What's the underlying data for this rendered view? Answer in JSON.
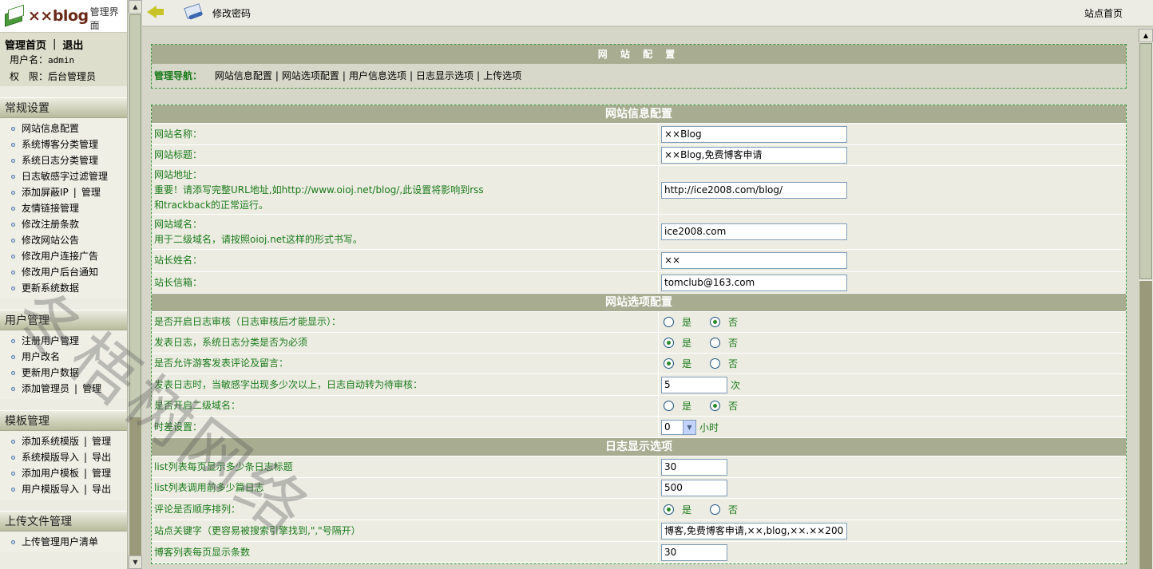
{
  "logo": {
    "brand": "××blog",
    "sub": "管理界面"
  },
  "user": {
    "home_link": "管理首页",
    "logout_link": "退出",
    "username_label": "用户名：",
    "username": "admin",
    "role_label": "权　限：",
    "role": "后台管理员"
  },
  "menu": {
    "s1": {
      "title": "常规设置",
      "items": [
        "网站信息配置",
        "系统博客分类管理",
        "系统日志分类管理",
        "日志敏感字过滤管理",
        "添加屏蔽IP",
        "管理",
        "友情链接管理",
        "修改注册条款",
        "修改网站公告",
        "修改用户连接广告",
        "修改用户后台通知",
        "更新系统数据"
      ]
    },
    "s2": {
      "title": "用户管理",
      "items": [
        "注册用户管理",
        "用户改名",
        "更新用户数据",
        "添加管理员",
        "管理"
      ]
    },
    "s3": {
      "title": "模板管理",
      "items": [
        "添加系统模版",
        "管理",
        "系统模版导入",
        "导出",
        "添加用户模板",
        "管理",
        "用户模版导入",
        "导出"
      ]
    },
    "s4": {
      "title": "上传文件管理",
      "items": [
        "上传管理用户清单"
      ]
    }
  },
  "topbar": {
    "title": "修改密码",
    "home": "站点首页"
  },
  "nav": {
    "header": "网 站 配 置",
    "label": "管理导航：",
    "links": [
      "网站信息配置",
      "网站选项配置",
      "用户信息选项",
      "日志显示选项",
      "上传选项"
    ]
  },
  "sections": {
    "info": {
      "title": "网站信息配置",
      "site_name_label": "网站名称：",
      "site_name": "××Blog",
      "site_title_label": "网站标题：",
      "site_title": "××Blog,免费博客申请",
      "site_url_label": "网站地址：",
      "site_url_note1": "重要！请添写完整URL地址,如http://www.oioj.net/blog/,此设置将影响到rss",
      "site_url_note2": "和trackback的正常运行。",
      "site_url": "http://ice2008.com/blog/",
      "domain_label": "网站域名：",
      "domain_note": "用于二级域名，请按照oioj.net这样的形式书写。",
      "domain": "ice2008.com",
      "owner_label": "站长姓名：",
      "owner": "××",
      "email_label": "站长信箱：",
      "email": "tomclub@163.com"
    },
    "options": {
      "title": "网站选项配置",
      "audit_label": "是否开启日志审核（日志审核后才能显示）：",
      "category_label": "发表日志，系统日志分类是否为必须",
      "guest_label": "是否允许游客发表评论及留言：",
      "sensitive_label": "发表日志时，当敏感字出现多少次以上，日志自动转为待审核：",
      "sensitive_value": "5",
      "sensitive_unit": "次",
      "subdomain_label": "是否开启二级域名：",
      "tz_label": "时差设置：",
      "tz_value": "0",
      "tz_unit": "小时",
      "yes": "是",
      "no": "否"
    },
    "display": {
      "title": "日志显示选项",
      "list_titles_label": "list列表每页显示多少条日志标题",
      "list_titles": "30",
      "list_recent_label": "list列表调用前多少篇日志",
      "list_recent": "500",
      "comment_order_label": "评论是否顺序排列：",
      "keywords_label": "站点关键字（更容易被搜索引擎找到,\",\"号隔开）",
      "keywords": "博客,免费博客申请,××,blog,××.××200",
      "blog_per_page_label": "博客列表每页显示条数",
      "blog_per_page": "30"
    }
  },
  "radios": {
    "audit": "no",
    "category": "yes",
    "guest": "yes",
    "subdomain": "no",
    "comment_order": "yes"
  },
  "watermark": "冬梧树网络",
  "colors": {
    "header": "#a8ac90",
    "label_green": "#1a7a1a",
    "dashed_border": "#3a9a3a"
  }
}
